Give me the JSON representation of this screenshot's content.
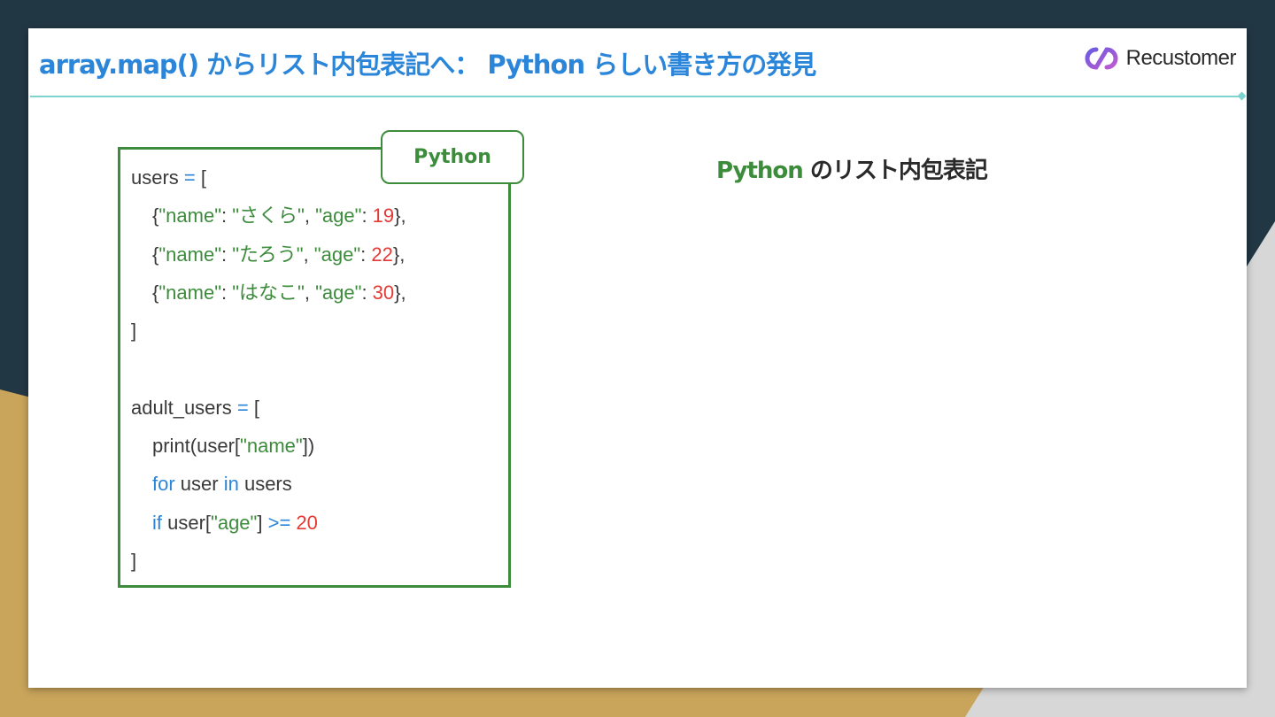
{
  "slide": {
    "title": "array.map() からリスト内包表記へ： Python らしい書き方の発見",
    "logo_text": "Recustomer",
    "logo_icon": "recustomer-logo-icon"
  },
  "code_panel": {
    "language_tab": "Python",
    "lines": [
      [
        {
          "t": "users ",
          "k": "plain"
        },
        {
          "t": "=",
          "k": "op"
        },
        {
          "t": " [",
          "k": "plain"
        }
      ],
      [
        {
          "t": "{",
          "k": "plain"
        },
        {
          "t": "\"name\"",
          "k": "str"
        },
        {
          "t": ": ",
          "k": "plain"
        },
        {
          "t": "\"さくら\"",
          "k": "str"
        },
        {
          "t": ", ",
          "k": "plain"
        },
        {
          "t": "\"age\"",
          "k": "str"
        },
        {
          "t": ": ",
          "k": "plain"
        },
        {
          "t": "19",
          "k": "num"
        },
        {
          "t": "},",
          "k": "plain"
        }
      ],
      [
        {
          "t": "{",
          "k": "plain"
        },
        {
          "t": "\"name\"",
          "k": "str"
        },
        {
          "t": ": ",
          "k": "plain"
        },
        {
          "t": "\"たろう\"",
          "k": "str"
        },
        {
          "t": ", ",
          "k": "plain"
        },
        {
          "t": "\"age\"",
          "k": "str"
        },
        {
          "t": ": ",
          "k": "plain"
        },
        {
          "t": "22",
          "k": "num"
        },
        {
          "t": "},",
          "k": "plain"
        }
      ],
      [
        {
          "t": "{",
          "k": "plain"
        },
        {
          "t": "\"name\"",
          "k": "str"
        },
        {
          "t": ": ",
          "k": "plain"
        },
        {
          "t": "\"はなこ\"",
          "k": "str"
        },
        {
          "t": ", ",
          "k": "plain"
        },
        {
          "t": "\"age\"",
          "k": "str"
        },
        {
          "t": ": ",
          "k": "plain"
        },
        {
          "t": "30",
          "k": "num"
        },
        {
          "t": "},",
          "k": "plain"
        }
      ],
      [
        {
          "t": "]",
          "k": "plain"
        }
      ],
      [],
      [
        {
          "t": "adult_users ",
          "k": "plain"
        },
        {
          "t": "=",
          "k": "op"
        },
        {
          "t": " [",
          "k": "plain"
        }
      ],
      [
        {
          "t": "print(user[",
          "k": "plain"
        },
        {
          "t": "\"name\"",
          "k": "str"
        },
        {
          "t": "])",
          "k": "plain"
        }
      ],
      [
        {
          "t": "for",
          "k": "kw"
        },
        {
          "t": " user ",
          "k": "plain"
        },
        {
          "t": "in",
          "k": "kw"
        },
        {
          "t": " users",
          "k": "plain"
        }
      ],
      [
        {
          "t": "if",
          "k": "kw"
        },
        {
          "t": " user[",
          "k": "plain"
        },
        {
          "t": "\"age\"",
          "k": "str"
        },
        {
          "t": "] ",
          "k": "plain"
        },
        {
          "t": ">=",
          "k": "op"
        },
        {
          "t": " ",
          "k": "plain"
        },
        {
          "t": "20",
          "k": "num"
        }
      ],
      [
        {
          "t": "]",
          "k": "plain"
        }
      ]
    ],
    "indented_lines": [
      1,
      2,
      3,
      7,
      8,
      9
    ]
  },
  "right_heading": {
    "accent": "Python",
    "rest": " のリスト内包表記"
  },
  "colors": {
    "title_blue": "#2b86d9",
    "code_green": "#3c8c3c",
    "number_red": "#e53935",
    "rule_teal": "#7fd3cf"
  }
}
